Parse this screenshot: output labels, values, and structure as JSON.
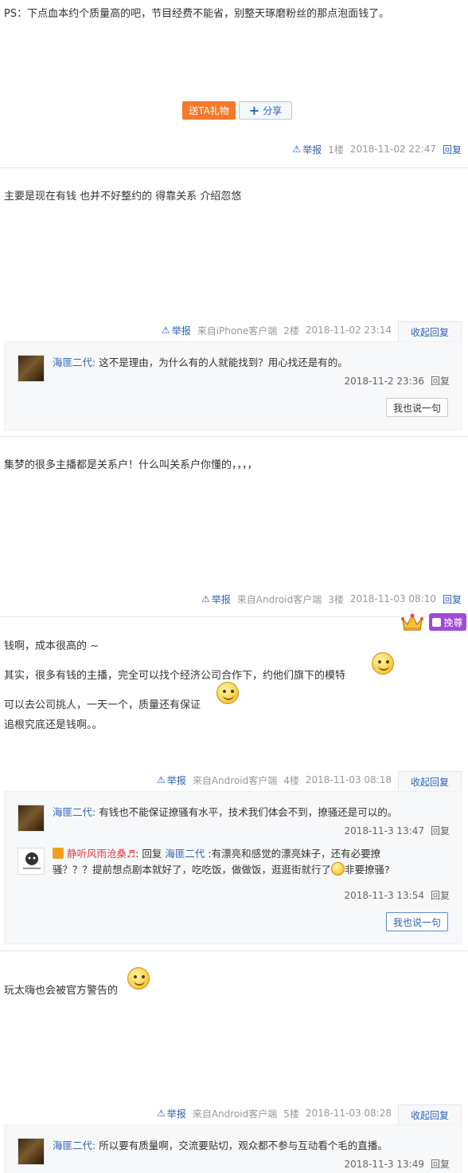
{
  "post1": {
    "text": "PS：下点血本约个质量高的吧，节目经费不能省，别整天琢磨粉丝的那点泡面钱了。",
    "gift_label": "送TA礼物",
    "share_label": "分享",
    "report": "举报",
    "floor": "1楼",
    "time": "2018-11-02 22:47",
    "reply": "回复"
  },
  "post2": {
    "text": "主要是现在有钱 也并不好整约的 得靠关系 介绍忽悠",
    "report": "举报",
    "source": "来自iPhone客户端",
    "floor": "2楼",
    "time": "2018-11-02 23:14",
    "collapse": "收起回复",
    "replies": [
      {
        "user": "海匪二代:",
        "text": "这不是理由，为什么有的人就能找到？用心找还是有的。",
        "time": "2018-11-2 23:36",
        "reply": "回复"
      }
    ],
    "say_button": "我也说一句"
  },
  "post3": {
    "text": "集梦的很多主播都是关系户！什么叫关系户你懂的，，，，",
    "report": "举报",
    "source": "来自Android客户端",
    "floor": "3楼",
    "time": "2018-11-03 08:10",
    "reply": "回复",
    "badge": "挽尊"
  },
  "post4": {
    "line1": "钱啊，成本很高的 ~",
    "line2": "其实，很多有钱的主播，完全可以找个经济公司合作下，约他们旗下的模特",
    "line3": "可以去公司挑人，一天一个，质量还有保证",
    "line4": "追根究底还是钱啊。。",
    "report": "举报",
    "source": "来自Android客户端",
    "floor": "4楼",
    "time": "2018-11-03 08:18",
    "collapse": "收起回复",
    "replies": [
      {
        "user": "海匪二代:",
        "text": "有钱也不能保证撩骚有水平，技术我们体会不到，撩骚还是可以的。",
        "time": "2018-11-3 13:47",
        "reply": "回复"
      },
      {
        "user": "静听风雨沧桑♬",
        "reply_word": ": 回复 ",
        "target": "海匪二代",
        "text1": " :有漂亮和感觉的漂亮妹子，还有必要撩",
        "text2": "骚？？？提前想点剧本就好了，吃吃饭，做做饭，逛逛街就行了",
        "text3": "非要撩骚?",
        "time": "2018-11-3 13:54",
        "reply": "回复"
      }
    ],
    "say_button": "我也说一句"
  },
  "post5": {
    "text": "玩太嗨也会被官方警告的",
    "report": "举报",
    "source": "来自Android客户端",
    "floor": "5楼",
    "time": "2018-11-03 08:28",
    "collapse": "收起回复",
    "replies": [
      {
        "user": "海匪二代:",
        "text": "所以要有质量啊，交流要贴切，观众都不参与互动看个毛的直播。",
        "time": "2018-11-3 13:49",
        "reply": "回复"
      }
    ]
  },
  "colors": {
    "link": "#2d64b3",
    "gift": "#f5792a",
    "badge": "#a04ad6",
    "username_red": "#e33b3b"
  },
  "icons": [
    "warning-icon",
    "plus-icon",
    "crown-icon",
    "smiley-icon"
  ]
}
